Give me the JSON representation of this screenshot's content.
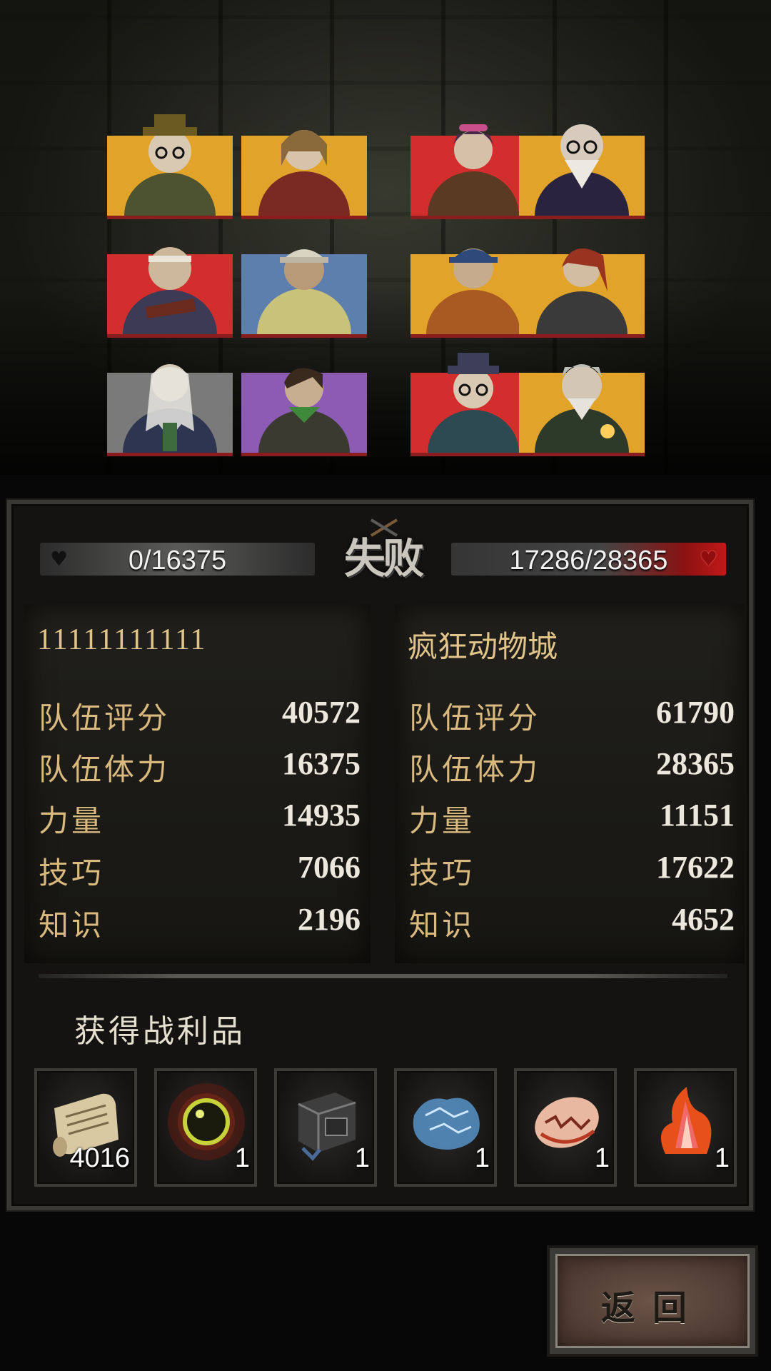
{
  "battle": {
    "result": "失败",
    "left_hp": "0/16375",
    "right_hp": "17286/28365",
    "left_heart_icon": "heart-icon",
    "right_heart_icon": "heart-icon"
  },
  "left_team": {
    "name": "11111111111",
    "stats": [
      {
        "label": "队伍评分",
        "value": "40572"
      },
      {
        "label": "队伍体力",
        "value": "16375"
      },
      {
        "label": "力量",
        "value": "14935"
      },
      {
        "label": "技巧",
        "value": "7066"
      },
      {
        "label": "知识",
        "value": "2196"
      }
    ],
    "members": [
      {
        "icon": "explorer-with-hat-portrait",
        "color": "#e2a32a"
      },
      {
        "icon": "woman-in-red-jacket-portrait",
        "color": "#e2a32a"
      },
      {
        "icon": "man-with-headband-portrait",
        "color": "#d32e2e"
      },
      {
        "icon": "man-in-cap-portrait",
        "color": "#5d7fae"
      },
      {
        "icon": "white-bearded-elder-portrait",
        "color": "#7a7a7a"
      },
      {
        "icon": "young-man-with-scarf-portrait",
        "color": "#8c5bb4"
      }
    ]
  },
  "right_team": {
    "name": "疯狂动物城",
    "stats": [
      {
        "label": "队伍评分",
        "value": "61790"
      },
      {
        "label": "队伍体力",
        "value": "28365"
      },
      {
        "label": "力量",
        "value": "11151"
      },
      {
        "label": "技巧",
        "value": "17622"
      },
      {
        "label": "知识",
        "value": "4652"
      }
    ],
    "members": [
      {
        "icon": "woman-with-goggles-portrait",
        "color": "#d32e2e"
      },
      {
        "icon": "bald-old-man-portrait",
        "color": "#e2a32a"
      },
      {
        "icon": "man-in-blue-cap-portrait",
        "color": "#e2a32a"
      },
      {
        "icon": "red-haired-woman-portrait",
        "color": "#e2a32a"
      },
      {
        "icon": "explorer-with-hat-portrait",
        "color": "#d32e2e"
      },
      {
        "icon": "grey-haired-old-man-portrait",
        "color": "#e2a32a"
      }
    ]
  },
  "loot": {
    "title": "获得战利品",
    "items": [
      {
        "icon": "scroll-icon",
        "qty": "4016"
      },
      {
        "icon": "glowing-orb-icon",
        "qty": "1"
      },
      {
        "icon": "metal-crate-icon",
        "qty": "1"
      },
      {
        "icon": "ice-crystal-icon",
        "qty": "1"
      },
      {
        "icon": "cracked-egg-icon",
        "qty": "1"
      },
      {
        "icon": "fire-crystal-icon",
        "qty": "1"
      }
    ]
  },
  "return_button": {
    "label": "返回"
  }
}
